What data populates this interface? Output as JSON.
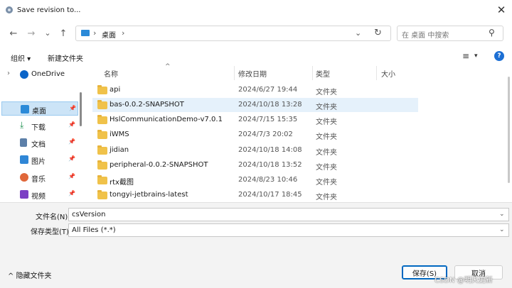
{
  "window": {
    "title": "Save revision to...",
    "close": "✕"
  },
  "nav": {
    "back": "←",
    "forward": "→",
    "recent": "⌄",
    "up": "↑",
    "breadcrumb": [
      "桌面"
    ],
    "search_placeholder": "在 桌面 中搜索"
  },
  "toolbar": {
    "organize": "组织 ▾",
    "new_folder": "新建文件夹"
  },
  "sidebar": {
    "items": [
      {
        "label": "OneDrive",
        "icon": "cloud-icon",
        "color": "#0a64c8"
      },
      {
        "label": "桌面",
        "icon": "desktop-icon",
        "color": "#2b8ad8"
      },
      {
        "label": "下载",
        "icon": "download-icon",
        "color": "#1b8f4e"
      },
      {
        "label": "文档",
        "icon": "document-icon",
        "color": "#5c7fa8"
      },
      {
        "label": "图片",
        "icon": "picture-icon",
        "color": "#2f86d6"
      },
      {
        "label": "音乐",
        "icon": "music-icon",
        "color": "#e0673a"
      },
      {
        "label": "视频",
        "icon": "video-icon",
        "color": "#7b3fc4"
      }
    ]
  },
  "columns": {
    "name": "名称",
    "date": "修改日期",
    "type": "类型",
    "size": "大小"
  },
  "files": [
    {
      "name": "api",
      "date": "2024/6/27 19:44",
      "type": "文件夹"
    },
    {
      "name": "bas-0.0.2-SNAPSHOT",
      "date": "2024/10/18 13:28",
      "type": "文件夹"
    },
    {
      "name": "HslCommunicationDemo-v7.0.1",
      "date": "2024/7/15 15:35",
      "type": "文件夹"
    },
    {
      "name": "iWMS",
      "date": "2024/7/3 20:02",
      "type": "文件夹"
    },
    {
      "name": "jidian",
      "date": "2024/10/18 14:08",
      "type": "文件夹"
    },
    {
      "name": "peripheral-0.0.2-SNAPSHOT",
      "date": "2024/10/18 13:52",
      "type": "文件夹"
    },
    {
      "name": "rtx截图",
      "date": "2024/8/23 10:46",
      "type": "文件夹"
    },
    {
      "name": "tongyi-jetbrains-latest",
      "date": "2024/10/17 18:45",
      "type": "文件夹"
    }
  ],
  "form": {
    "filename_label": "文件名(N):",
    "filename_value": "csVersion",
    "filetype_label": "保存类型(T):",
    "filetype_value": "All Files (*.*)"
  },
  "footer": {
    "hide_folders": "隐藏文件夹",
    "save": "保存(S)",
    "cancel": "取消",
    "watermark": "CSDN @明天更新"
  }
}
